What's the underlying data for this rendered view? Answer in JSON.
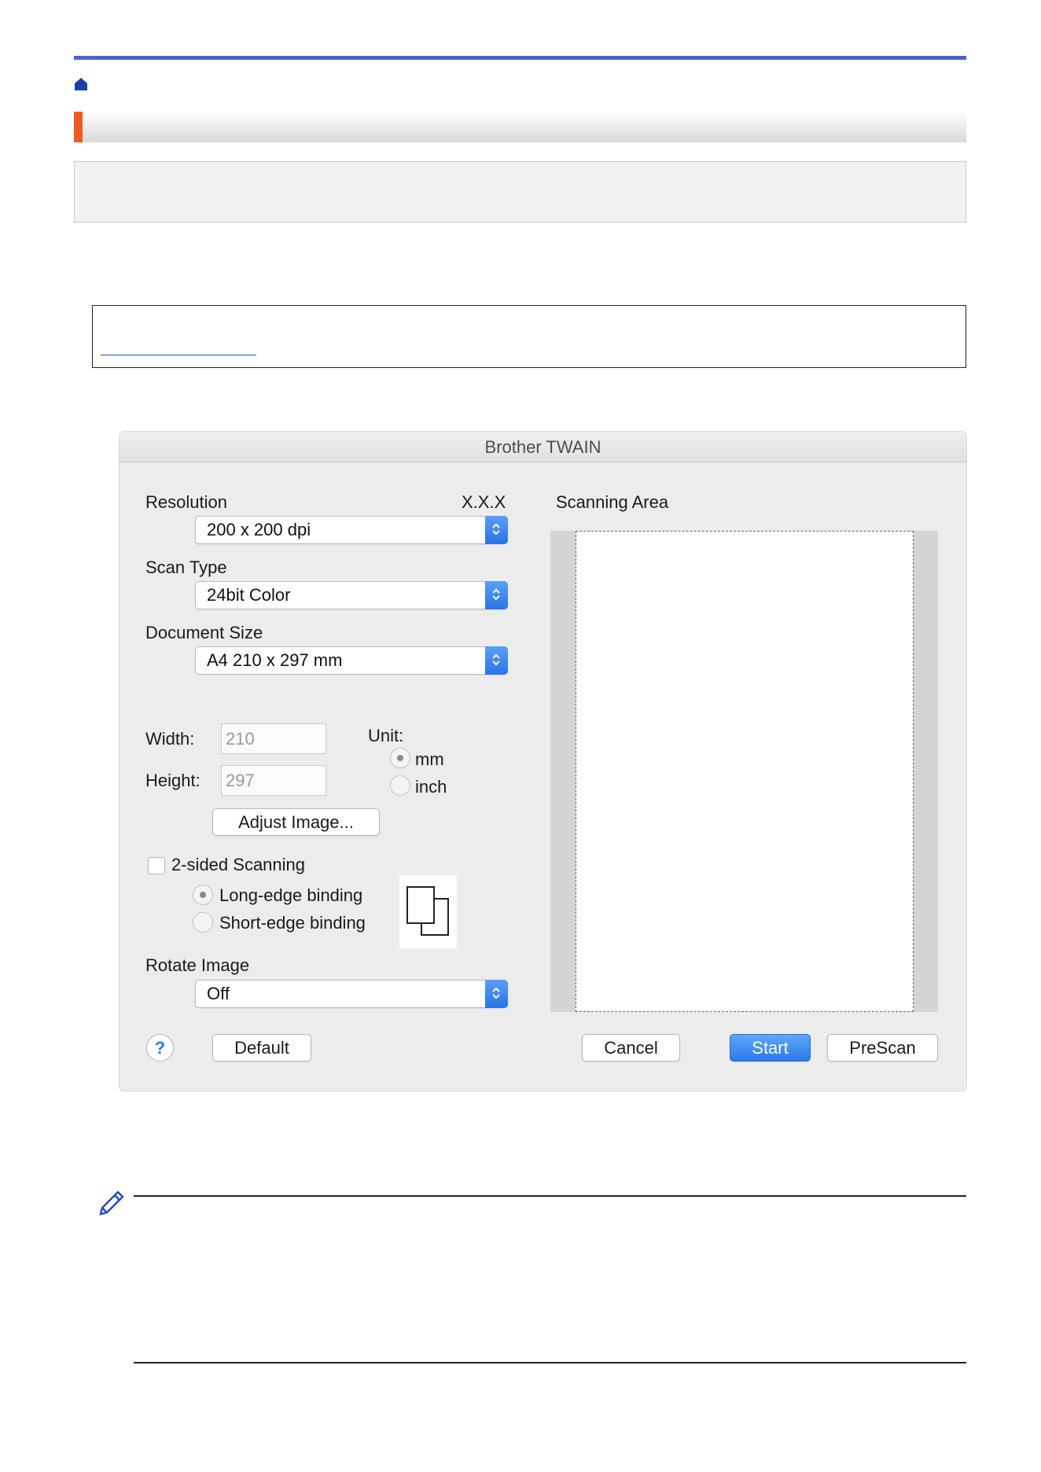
{
  "dialog": {
    "title": "Brother TWAIN",
    "resolution": {
      "label": "Resolution",
      "version": "X.X.X",
      "value": "200 x 200 dpi"
    },
    "scan_type": {
      "label": "Scan Type",
      "value": "24bit Color"
    },
    "document_size": {
      "label": "Document Size",
      "value": "A4  210 x 297 mm"
    },
    "width": {
      "label": "Width:",
      "value": "210"
    },
    "height": {
      "label": "Height:",
      "value": "297"
    },
    "unit": {
      "label": "Unit:",
      "options": [
        "mm",
        "inch"
      ],
      "selected": "mm"
    },
    "adjust_image_label": "Adjust Image...",
    "two_sided": {
      "label": "2-sided Scanning",
      "checked": false
    },
    "binding": {
      "options": [
        "Long-edge binding",
        "Short-edge binding"
      ],
      "selected": "Long-edge binding"
    },
    "rotate_image": {
      "label": "Rotate Image",
      "value": "Off"
    },
    "scanning_area_label": "Scanning Area",
    "buttons": {
      "help": "?",
      "default": "Default",
      "cancel": "Cancel",
      "start": "Start",
      "prescan": "PreScan"
    }
  },
  "colors": {
    "top_bar": "#4a63d8",
    "section_accent": "#f05a1e",
    "primary_button": "#2b78e8"
  },
  "icons": [
    "home-icon",
    "chevron-updown-icon",
    "help-icon",
    "binding-pages-icon",
    "pencil-note-icon"
  ]
}
